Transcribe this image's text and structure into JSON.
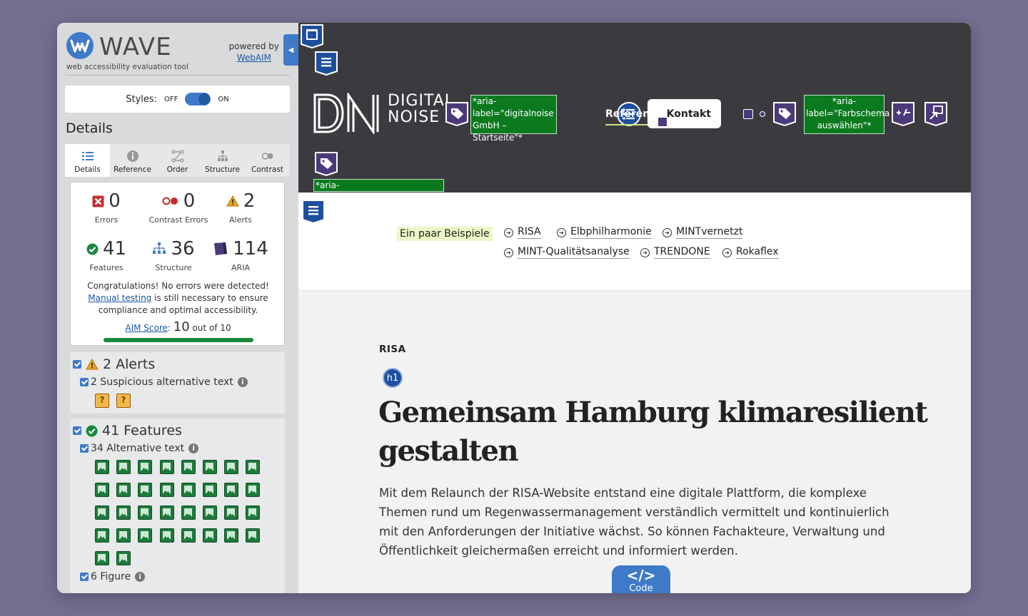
{
  "wave": {
    "title": "WAVE",
    "tagline": "web accessibility evaluation tool",
    "powered_by": "powered by",
    "webaim": "WebAIM",
    "styles_label": "Styles:",
    "styles_off": "OFF",
    "styles_on": "ON",
    "details_heading": "Details",
    "tabs": [
      "Details",
      "Reference",
      "Order",
      "Structure",
      "Contrast"
    ],
    "stats": {
      "errors": {
        "value": "0",
        "label": "Errors"
      },
      "contrast": {
        "value": "0",
        "label": "Contrast Errors"
      },
      "alerts": {
        "value": "2",
        "label": "Alerts"
      },
      "features": {
        "value": "41",
        "label": "Features"
      },
      "structure": {
        "value": "36",
        "label": "Structure"
      },
      "aria": {
        "value": "114",
        "label": "ARIA"
      }
    },
    "congrats_pre": "Congratulations! No errors were detected! ",
    "congrats_link": "Manual testing",
    "congrats_post": " is still necessary to ensure compliance and optimal accessibility.",
    "aim_link": "AIM Score",
    "aim_sep": ":",
    "aim_score": "10",
    "aim_suffix": "out of 10",
    "alerts_heading": "2 Alerts",
    "alerts_item": "2 Suspicious alternative text",
    "features_heading": "41 Features",
    "features_item1": "34 Alternative text",
    "features_item2": "6 Figure",
    "icon_glyphs": {
      "info": "i",
      "alert_tile": "?",
      "collapse": "◀"
    }
  },
  "site": {
    "logo_line1": "DIGITAL",
    "logo_line2": "NOISE",
    "aria_home": "*aria-label=\"digitalnoise GmbH – Startseite\"*",
    "aria_scheme": "*aria-label=\"Farbschema auswählen\"*",
    "aria_nav": "*aria-label=\"Hauptnavigation\"*",
    "nav_link": "Referenz",
    "kontakt": "Kontakt",
    "sub_label": "Ein paar Beispiele",
    "sublinks": [
      "RISA",
      "Elbphilharmonie",
      "MINTvernetzt",
      "MINT-Qualitätsanalyse",
      "TRENDONE",
      "Rokaflex"
    ],
    "eyebrow": "RISA",
    "h1_badge": "h1",
    "headline": "Gemeinsam Hamburg klimaresilient gestalten",
    "lead": "Mit dem Relaunch der RISA-Website entstand eine digitale Plattform, die komplexe Themen rund um Regenwassermanagement verständlich vermittelt und kontinuierlich mit den Anforderungen der Initiative wächst. So können Fachakteure, Verwaltung und Öffentlichkeit gleichermaßen erreicht und informiert werden.",
    "code_glyph": "</>",
    "code_label": "Code"
  },
  "colors": {
    "wave_blue": "#3f7ac8",
    "header_bg": "#3b3b3f",
    "aria_green": "#0b7a1f",
    "feature_green": "#1d7a3c",
    "error_red": "#c62d2d",
    "alert_amber": "#e9a426",
    "aria_purple": "#4b3a7a"
  }
}
